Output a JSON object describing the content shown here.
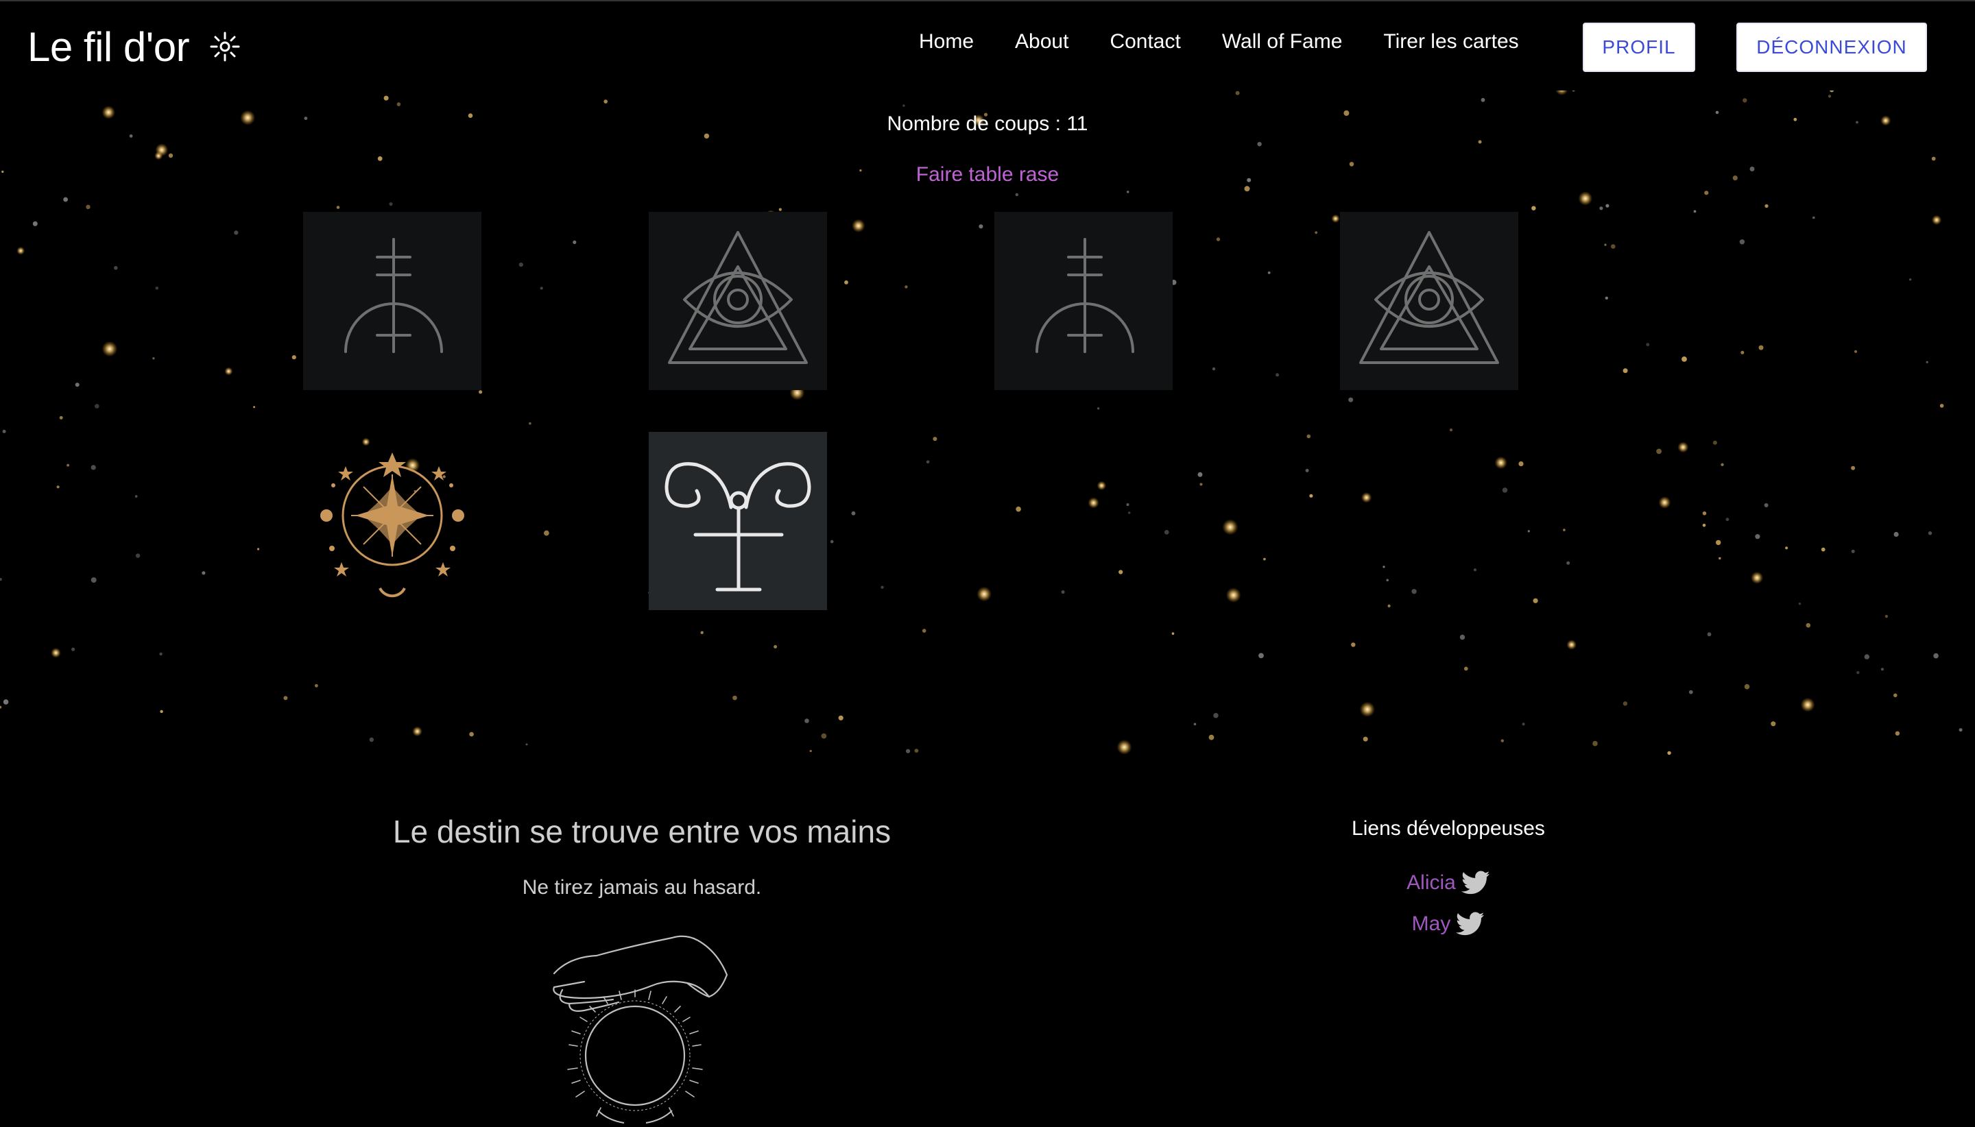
{
  "navbar": {
    "brand": "Le fil d'or",
    "brand_icon": "sun-sparkle-icon",
    "links": [
      "Home",
      "About",
      "Contact",
      "Wall of Fame",
      "Tirer les cartes"
    ],
    "profil_label": "PROFIL",
    "deconnexion_label": "DÉCONNEXION"
  },
  "game": {
    "coups_text": "Nombre de coups : 11",
    "reset_label": "Faire table rase",
    "cards": [
      {
        "symbol": "alchemical-cross-icon",
        "state": "matched"
      },
      {
        "symbol": "all-seeing-eye-icon",
        "state": "matched"
      },
      {
        "symbol": "alchemical-cross-icon",
        "state": "matched"
      },
      {
        "symbol": "all-seeing-eye-icon",
        "state": "matched"
      },
      {
        "symbol": "card-back-sun-icon",
        "state": "face-down"
      },
      {
        "symbol": "aries-symbol-icon",
        "state": "revealed"
      }
    ]
  },
  "footer": {
    "title": "Le destin se trouve entre vos mains",
    "subtitle": "Ne tirez jamais au hasard.",
    "illustration": "hand-crystal-ball-icon",
    "dev_heading": "Liens développeuses",
    "devs": [
      {
        "name": "Alicia",
        "icon": "twitter-icon"
      },
      {
        "name": "May",
        "icon": "twitter-icon"
      }
    ]
  },
  "colors": {
    "background": "#000000",
    "accent_purple": "#c063d6",
    "dev_link": "#a058c0",
    "button_text": "#3b4bd8",
    "card_matched": "#101214",
    "card_revealed": "#25282b",
    "gold": "#c9975a"
  }
}
